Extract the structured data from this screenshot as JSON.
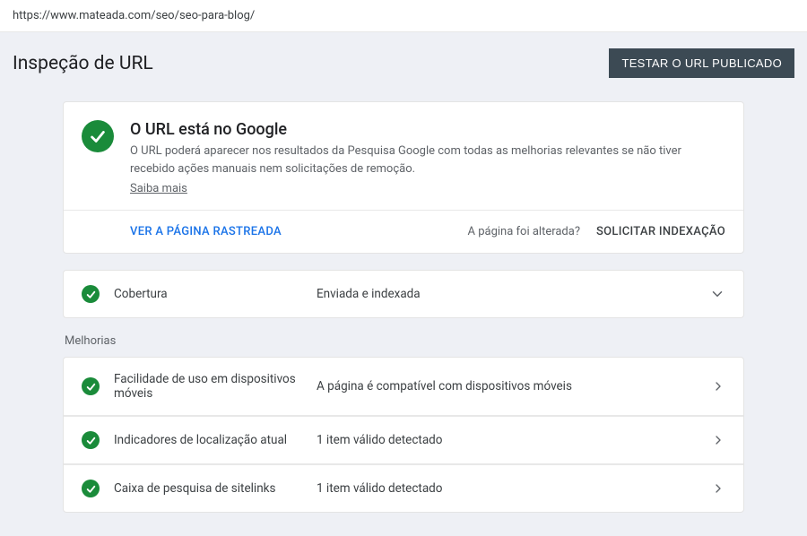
{
  "url": "https://www.mateada.com/seo/seo-para-blog/",
  "page_title": "Inspeção de URL",
  "test_button": "TESTAR O URL PUBLICADO",
  "status": {
    "heading": "O URL está no Google",
    "description": "O URL poderá aparecer nos resultados da Pesquisa Google com todas as melhorias relevantes se não tiver recebido ações manuais nem solicitações de remoção.",
    "learn_more": "Saiba mais"
  },
  "actions": {
    "view_crawled": "VER A PÁGINA RASTREADA",
    "page_changed": "A página foi alterada?",
    "request_index": "SOLICITAR INDEXAÇÃO"
  },
  "coverage": {
    "label": "Cobertura",
    "value": "Enviada e indexada"
  },
  "improvements_label": "Melhorias",
  "improvements": [
    {
      "label": "Facilidade de uso em dispositivos móveis",
      "value": "A página é compatível com dispositivos móveis"
    },
    {
      "label": "Indicadores de localização atual",
      "value": "1 item válido detectado"
    },
    {
      "label": "Caixa de pesquisa de sitelinks",
      "value": "1 item válido detectado"
    }
  ]
}
